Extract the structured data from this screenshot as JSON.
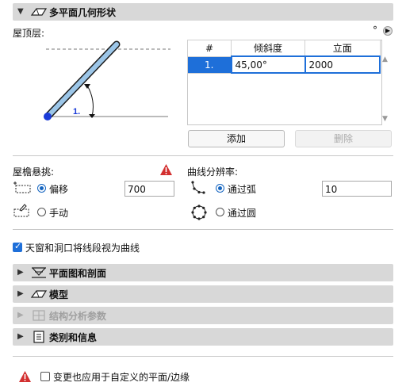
{
  "top_header": {
    "title": "多平面几何形状",
    "icon": "roof-multiplane-icon"
  },
  "roof_level": {
    "label": "屋顶层:",
    "unit_symbol": "°",
    "diagram_label": "1.",
    "table": {
      "headers": [
        "#",
        "倾斜度",
        "立面"
      ],
      "rows": [
        {
          "num": "1.",
          "slope": "45,00°",
          "elevation": "2000"
        }
      ]
    },
    "add_button": "添加",
    "delete_button": "删除"
  },
  "eaves": {
    "label": "屋檐悬挑:",
    "offset_label": "偏移",
    "offset_value": "700",
    "manual_label": "手动",
    "selected": "offset"
  },
  "curve": {
    "label": "曲线分辨率:",
    "arc_label": "通过弧",
    "arc_value": "10",
    "circle_label": "通过圆",
    "selected": "arc"
  },
  "checkbox_skylight": {
    "label": "天窗和洞口将线段视为曲线",
    "checked": true
  },
  "sections": [
    {
      "label": "平面图和剖面",
      "icon": "floor-plan-section-icon",
      "enabled": true
    },
    {
      "label": "模型",
      "icon": "model-icon",
      "enabled": true
    },
    {
      "label": "结构分析参数",
      "icon": "structural-analysis-icon",
      "enabled": false
    },
    {
      "label": "类别和信息",
      "icon": "category-info-icon",
      "enabled": true
    }
  ],
  "footer": {
    "label": "变更也应用于自定义的平面/边缘",
    "checked": false
  },
  "colors": {
    "accent": "#1565c0",
    "selection": "#1e6fd9",
    "header_bg": "#d8d8d8",
    "warning": "#d32f2f"
  }
}
